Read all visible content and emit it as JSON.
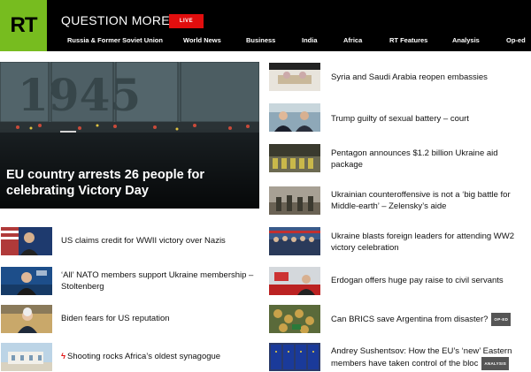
{
  "header": {
    "logo": "RT",
    "slogan": "QUESTION MORE",
    "live_label": "LIVE",
    "nav": [
      "Russia & Former Soviet Union",
      "World News",
      "Business",
      "India",
      "Africa",
      "RT Features",
      "Analysis",
      "Op-ed"
    ]
  },
  "hero": {
    "title": "EU country arrests 26 people for celebrating Victory Day",
    "image_text": "1945"
  },
  "left_items": [
    {
      "title": "US claims credit for WWII victory over Nazis",
      "thumb": "speaker-thumbnail"
    },
    {
      "title": "‘All’ NATO members support Ukraine membership – Stoltenberg",
      "thumb": "nato-thumbnail"
    },
    {
      "title": "Biden fears for US reputation",
      "thumb": "biden-thumbnail"
    },
    {
      "title": "Shooting rocks Africa’s oldest synagogue",
      "thumb": "synagogue-thumbnail",
      "icon": "lightning-icon"
    }
  ],
  "right_items": [
    {
      "title": "Syria and Saudi Arabia reopen embassies",
      "thumb": "meeting-thumbnail"
    },
    {
      "title": "Trump guilty of sexual battery – court",
      "thumb": "trump-thumbnail"
    },
    {
      "title": "Pentagon announces $1.2 billion Ukraine aid package",
      "thumb": "pentagon-thumbnail"
    },
    {
      "title": "Ukrainian counteroffensive is not a ‘big battle for Middle-earth’ – Zelensky’s aide",
      "thumb": "soldiers-thumbnail"
    },
    {
      "title": "Ukraine blasts foreign leaders for attending WW2 victory celebration",
      "thumb": "parade-thumbnail"
    },
    {
      "title": "Erdogan offers huge pay raise to civil servants",
      "thumb": "erdogan-thumbnail"
    },
    {
      "title": "Can BRICS save Argentina from disaster?",
      "thumb": "coins-thumbnail",
      "tag": "OP-ED"
    },
    {
      "title": "Andrey Sushentsov: How the EU’s ‘new’ Eastern members have taken control of the bloc",
      "thumb": "eu-flags-thumbnail",
      "tag": "ANALYSIS"
    }
  ],
  "colors": {
    "brand_green": "#77bc1f",
    "live_red": "#e10e0e",
    "header_bg": "#000000"
  }
}
